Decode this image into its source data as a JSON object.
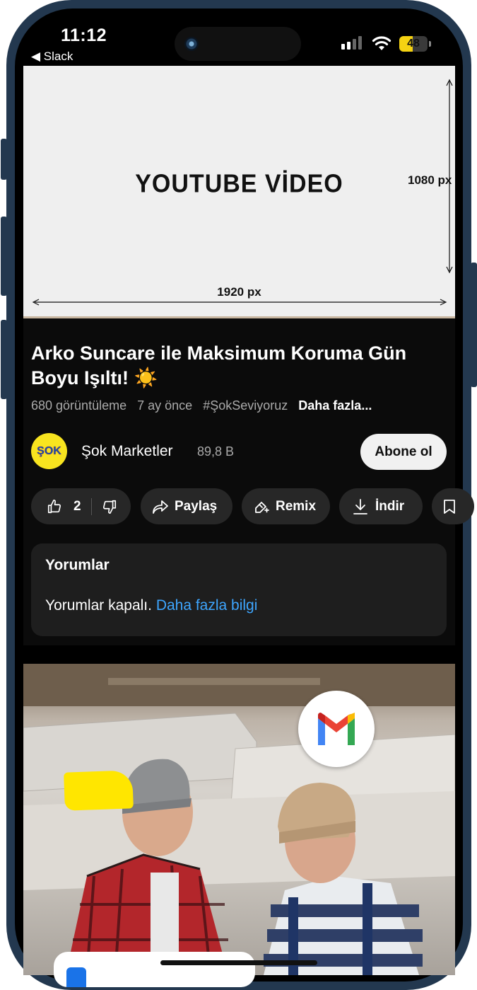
{
  "status_bar": {
    "time": "11:12",
    "back_app": "◀ Slack",
    "battery": "48"
  },
  "video_placeholder": {
    "title": "YOUTUBE VİDEO",
    "height_label": "1080 px",
    "width_label": "1920 px"
  },
  "video": {
    "title": "Arko Suncare ile Maksimum Koruma Gün Boyu Işıltı! ☀️",
    "views": "680 görüntüleme",
    "age": "7 ay önce",
    "hashtag": "#ŞokSeviyoruz",
    "more": "Daha fazla..."
  },
  "channel": {
    "avatar_text": "ŞOK",
    "name": "Şok Marketler",
    "subscribers": "89,8 B",
    "subscribe_label": "Abone ol"
  },
  "actions": {
    "like_count": "2",
    "share_label": "Paylaş",
    "remix_label": "Remix",
    "download_label": "İndir"
  },
  "comments": {
    "title": "Yorumlar",
    "text": "Yorumlar kapalı.",
    "link": "Daha fazla bilgi"
  },
  "colors": {
    "frame": "#23384f",
    "background": "#0b0b0b",
    "chip": "#272727",
    "link": "#3ea6ff",
    "battery": "#f5d312"
  }
}
